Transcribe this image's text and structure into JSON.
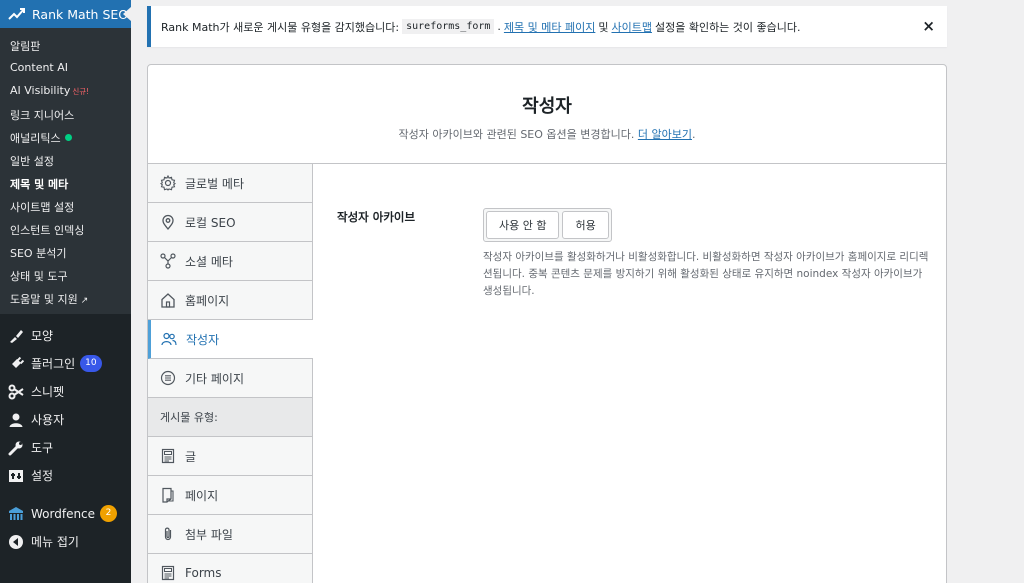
{
  "sidebar": {
    "rank_math_title": "Rank Math SEO",
    "submenu": [
      {
        "label": "알림판"
      },
      {
        "label": "Content AI"
      },
      {
        "label": "AI Visibility",
        "tag": "신규!"
      },
      {
        "label": "링크 지니어스"
      },
      {
        "label": "애널리틱스"
      },
      {
        "label": "일반 설정"
      },
      {
        "label": "제목 및 메타"
      },
      {
        "label": "사이트맵 설정"
      },
      {
        "label": "인스턴트 인덱싱"
      },
      {
        "label": "SEO 분석기"
      },
      {
        "label": "상태 및 도구"
      },
      {
        "label": "도움말 및 지원",
        "ext": "↗"
      }
    ],
    "menu": [
      {
        "label": "모양",
        "icon": "paintbrush-icon"
      },
      {
        "label": "플러그인",
        "icon": "plugin-icon",
        "badge": "10"
      },
      {
        "label": "스니펫",
        "icon": "snippets-icon"
      },
      {
        "label": "사용자",
        "icon": "users-icon"
      },
      {
        "label": "도구",
        "icon": "wrench-icon"
      },
      {
        "label": "설정",
        "icon": "settings-icon"
      },
      {
        "label": "Wordfence",
        "icon": "wordfence-icon",
        "badge": "2"
      },
      {
        "label": "메뉴 접기",
        "icon": "collapse-icon"
      }
    ]
  },
  "notice": {
    "text_before": "Rank Math가 새로운 게시물 유형을 감지했습니다:",
    "code": "sureforms_form",
    "dot": ".",
    "link1": "제목 및 메타 페이지",
    "and": "및",
    "link2": "사이트맵",
    "text_after": "설정을 확인하는 것이 좋습니다.",
    "close": "×"
  },
  "page": {
    "title": "작성자",
    "desc": "작성자 아카이브와 관련된 SEO 옵션을 변경합니다.",
    "learn_more": "더 알아보기",
    "period": "."
  },
  "tabs": [
    {
      "label": "글로벌 메타",
      "icon": "gear-icon"
    },
    {
      "label": "로컬 SEO",
      "icon": "location-pin-icon"
    },
    {
      "label": "소셜 메타",
      "icon": "social-icon"
    },
    {
      "label": "홈페이지",
      "icon": "home-icon"
    },
    {
      "label": "작성자",
      "icon": "users-icon"
    },
    {
      "label": "기타 페이지",
      "icon": "list-circle-icon"
    },
    {
      "label": "게시물 유형:"
    },
    {
      "label": "글",
      "icon": "post-icon"
    },
    {
      "label": "페이지",
      "icon": "page-icon"
    },
    {
      "label": "첨부 파일",
      "icon": "paperclip-icon"
    },
    {
      "label": "Forms",
      "icon": "forms-icon"
    }
  ],
  "field": {
    "label": "작성자 아카이브",
    "options": [
      "사용 안 함",
      "허용"
    ],
    "description": "작성자 아카이브를 활성화하거나 비활성화합니다. 비활성화하면 작성자 아카이브가 홈페이지로 리디렉션됩니다. 중복 콘텐츠 문제를 방지하기 위해 활성화된 상태로 유지하면 noindex 작성자 아카이브가 생성됩니다."
  },
  "colors": {
    "admin_bg": "#1d2327",
    "submenu_bg": "#2c3338",
    "accent": "#2271b1",
    "active_tab_border": "#4ea0d8",
    "badge_blue": "#3858e9",
    "badge_orange": "#f0a100",
    "status_green": "#00d084"
  }
}
